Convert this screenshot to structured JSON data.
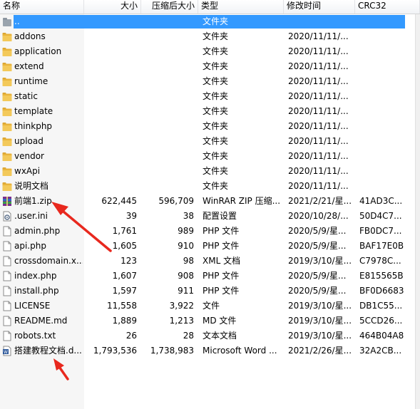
{
  "columns": {
    "name": "名称",
    "size": "大小",
    "packed": "压缩后大小",
    "type": "类型",
    "modified": "修改时间",
    "crc": "CRC32"
  },
  "rows": [
    {
      "name": "..",
      "size": "",
      "packed": "",
      "type": "文件夹",
      "modified": "",
      "crc": "",
      "icon": "up-folder-icon"
    },
    {
      "name": "addons",
      "size": "",
      "packed": "",
      "type": "文件夹",
      "modified": "2020/11/11/...",
      "crc": "",
      "icon": "folder-icon"
    },
    {
      "name": "application",
      "size": "",
      "packed": "",
      "type": "文件夹",
      "modified": "2020/11/11/...",
      "crc": "",
      "icon": "folder-icon"
    },
    {
      "name": "extend",
      "size": "",
      "packed": "",
      "type": "文件夹",
      "modified": "2020/11/11/...",
      "crc": "",
      "icon": "folder-icon"
    },
    {
      "name": "runtime",
      "size": "",
      "packed": "",
      "type": "文件夹",
      "modified": "2020/11/11/...",
      "crc": "",
      "icon": "folder-icon"
    },
    {
      "name": "static",
      "size": "",
      "packed": "",
      "type": "文件夹",
      "modified": "2020/11/11/...",
      "crc": "",
      "icon": "folder-icon"
    },
    {
      "name": "template",
      "size": "",
      "packed": "",
      "type": "文件夹",
      "modified": "2020/11/11/...",
      "crc": "",
      "icon": "folder-icon"
    },
    {
      "name": "thinkphp",
      "size": "",
      "packed": "",
      "type": "文件夹",
      "modified": "2020/11/11/...",
      "crc": "",
      "icon": "folder-icon"
    },
    {
      "name": "upload",
      "size": "",
      "packed": "",
      "type": "文件夹",
      "modified": "2020/11/11/...",
      "crc": "",
      "icon": "folder-icon"
    },
    {
      "name": "vendor",
      "size": "",
      "packed": "",
      "type": "文件夹",
      "modified": "2020/11/11/...",
      "crc": "",
      "icon": "folder-icon"
    },
    {
      "name": "wxApi",
      "size": "",
      "packed": "",
      "type": "文件夹",
      "modified": "2020/11/11/...",
      "crc": "",
      "icon": "folder-icon"
    },
    {
      "name": "说明文档",
      "size": "",
      "packed": "",
      "type": "文件夹",
      "modified": "2020/11/11/...",
      "crc": "",
      "icon": "folder-icon"
    },
    {
      "name": "前端1.zip",
      "size": "622,445",
      "packed": "596,709",
      "type": "WinRAR ZIP 压缩...",
      "modified": "2021/2/21/星...",
      "crc": "41AD3C...",
      "icon": "winrar-archive-icon"
    },
    {
      "name": ".user.ini",
      "size": "39",
      "packed": "38",
      "type": "配置设置",
      "modified": "2020/10/28/...",
      "crc": "50D4C7...",
      "icon": "settings-file-icon"
    },
    {
      "name": "admin.php",
      "size": "1,761",
      "packed": "989",
      "type": "PHP 文件",
      "modified": "2020/5/9/星...",
      "crc": "FB0DC7...",
      "icon": "file-icon"
    },
    {
      "name": "api.php",
      "size": "1,605",
      "packed": "910",
      "type": "PHP 文件",
      "modified": "2020/5/9/星...",
      "crc": "BAF17E0B",
      "icon": "file-icon"
    },
    {
      "name": "crossdomain.x...",
      "size": "123",
      "packed": "98",
      "type": "XML 文档",
      "modified": "2019/3/10/星...",
      "crc": "C7978C...",
      "icon": "file-icon"
    },
    {
      "name": "index.php",
      "size": "1,607",
      "packed": "908",
      "type": "PHP 文件",
      "modified": "2020/5/9/星...",
      "crc": "E815565B",
      "icon": "file-icon"
    },
    {
      "name": "install.php",
      "size": "1,597",
      "packed": "911",
      "type": "PHP 文件",
      "modified": "2020/5/9/星...",
      "crc": "BF0D6683",
      "icon": "file-icon"
    },
    {
      "name": "LICENSE",
      "size": "11,558",
      "packed": "3,922",
      "type": "文件",
      "modified": "2019/3/10/星...",
      "crc": "DB1C55...",
      "icon": "file-icon"
    },
    {
      "name": "README.md",
      "size": "1,889",
      "packed": "1,213",
      "type": "MD 文件",
      "modified": "2019/3/10/星...",
      "crc": "5CCD26...",
      "icon": "file-icon"
    },
    {
      "name": "robots.txt",
      "size": "26",
      "packed": "28",
      "type": "文本文档",
      "modified": "2019/3/10/星...",
      "crc": "464B04A8",
      "icon": "file-icon"
    },
    {
      "name": "搭建教程文档.d...",
      "size": "1,793,536",
      "packed": "1,738,983",
      "type": "Microsoft Word ...",
      "modified": "2021/2/26/星...",
      "crc": "32A2CB...",
      "icon": "word-document-icon"
    }
  ],
  "colors": {
    "selection": "#3399ff",
    "folder": "#e8b33c",
    "annotation_arrow": "#e8281e"
  }
}
